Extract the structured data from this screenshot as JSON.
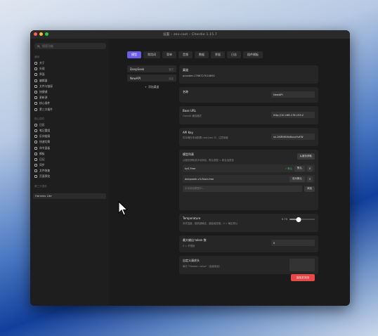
{
  "window": {
    "title": "设置 – zev-cast – Cherdie 1.15.7",
    "dots": [
      "#ff5f57",
      "#febc2e",
      "#28c840"
    ]
  },
  "sidebar": {
    "search_placeholder": "搜索功能",
    "section1": "通用",
    "items1": [
      {
        "label": "关于",
        "icon": "info-icon"
      },
      {
        "label": "外观",
        "icon": "palette-icon"
      },
      {
        "label": "界面",
        "icon": "layout-icon"
      },
      {
        "label": "编辑器",
        "icon": "edit-icon"
      },
      {
        "label": "文件与链接",
        "icon": "folder-icon"
      },
      {
        "label": "快捷键",
        "icon": "keyboard-icon"
      },
      {
        "label": "更新源",
        "icon": "refresh-icon"
      },
      {
        "label": "核心插件",
        "icon": "plugin-icon"
      },
      {
        "label": "第三方插件",
        "icon": "puzzle-icon"
      }
    ],
    "section2": "核心插件",
    "items2": [
      {
        "label": "日历",
        "icon": "calendar-icon"
      },
      {
        "label": "笔记重组",
        "icon": "merge-icon"
      },
      {
        "label": "反向链接",
        "icon": "backlink-icon"
      },
      {
        "label": "快速切换",
        "icon": "switch-icon"
      },
      {
        "label": "命令面板",
        "icon": "command-icon"
      },
      {
        "label": "模板",
        "icon": "template-icon"
      },
      {
        "label": "日记",
        "icon": "journal-icon"
      },
      {
        "label": "同步",
        "icon": "sync-icon"
      },
      {
        "label": "文件恢复",
        "icon": "restore-icon"
      },
      {
        "label": "页面预览",
        "icon": "preview-icon"
      }
    ],
    "section3": "第三方插件",
    "assistant_item": "Harness Lite"
  },
  "tabs": [
    "模型",
    "常用词",
    "背单",
    "音频",
    "数据",
    "界面",
    "日志",
    "插件模板"
  ],
  "active_tab": 0,
  "providers": [
    {
      "name": "DeepSeek",
      "tag": "官方"
    },
    {
      "name": "NewAPI",
      "tag": "自定"
    }
  ],
  "add_provider": "添加渠道",
  "form": {
    "channel_label": "渠道",
    "channel_id": "provider-1766727010692",
    "name_label": "名称",
    "name_value": "NewAPI",
    "baseurl_label": "Base URL",
    "baseurl_sub": "OpenAI 兼容格式",
    "baseurl_value": "http://10.168.178.153:2",
    "apikey_label": "API Key",
    "apikey_sub": "仅存储在本地配置 cast.json 中，注意保管",
    "apikey_value": "sk-2KIRHKHbBxxx9uFW",
    "models_label": "模型列表",
    "models_sub": "从服务获取或手动添加，默认模型 = 新会话首选",
    "fetch_button": "从服务获取",
    "models": [
      {
        "name": "kyS-Free",
        "badge": "✓ 默认",
        "action": "默认"
      },
      {
        "name": "deepseek-v3-flash-free",
        "badge": "",
        "action": "设为默认"
      }
    ],
    "add_model_placeholder": "手动添加模型ID...",
    "add_model_button": "添加",
    "temp_label": "Temperature",
    "temp_sub": "采样温度，越低越确定，越高越发散；0 = 确定默认",
    "temp_value": "0.70",
    "maxout_label": "最大输出 token 数",
    "maxout_sub": "0 = 不限制",
    "maxout_value": "0",
    "headers_label": "自定义请求头",
    "headers_sub": "每行 \"Header: value\"（高级用途）",
    "save_button": "保存并关闭"
  }
}
